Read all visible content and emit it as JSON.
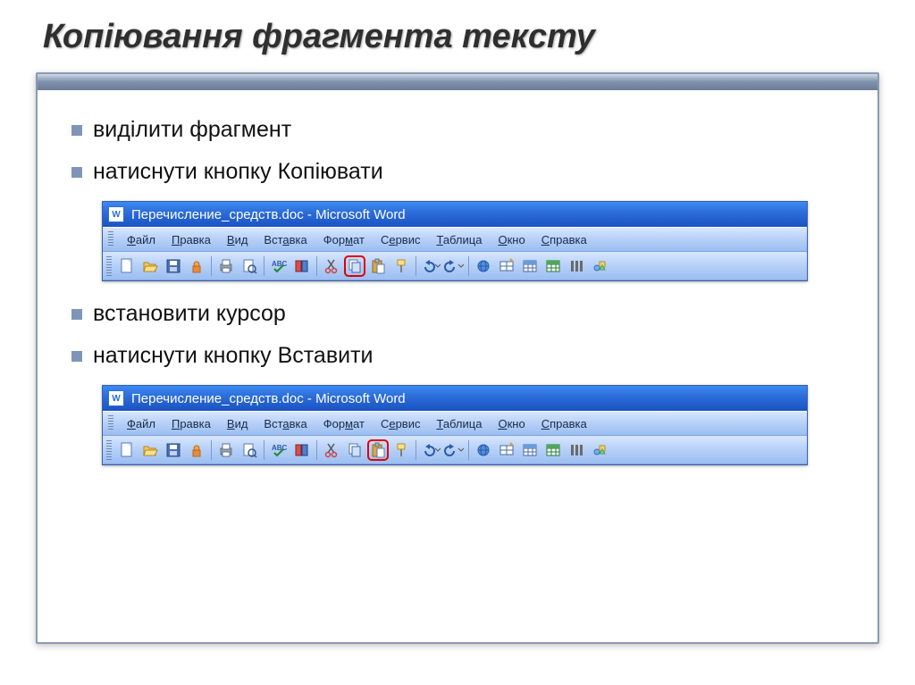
{
  "title": "Копіювання фрагмента тексту",
  "bullets": {
    "b1": "виділити фрагмент",
    "b2": "натиснути кнопку Копіювати",
    "b3": "встановити курсор",
    "b4": "натиснути кнопку Вставити"
  },
  "word": {
    "doctitle": "Перечисление_средств.doc - Microsoft Word",
    "menu": {
      "file": "Файл",
      "edit": "Правка",
      "view": "Вид",
      "insert": "Вставка",
      "format": "Формат",
      "tools": "Сервис",
      "table": "Таблица",
      "window": "Окно",
      "help": "Справка"
    },
    "icons": {
      "new": "new-doc-icon",
      "open": "open-folder-icon",
      "save": "save-icon",
      "perm": "permission-icon",
      "print": "print-icon",
      "preview": "print-preview-icon",
      "spell": "spelling-icon",
      "research": "research-icon",
      "cut": "cut-icon",
      "copy": "copy-icon",
      "paste": "paste-icon",
      "painter": "format-painter-icon",
      "undo": "undo-icon",
      "redo": "redo-icon",
      "link": "hyperlink-icon",
      "tables": "tables-borders-icon",
      "instable": "insert-table-icon",
      "excel": "insert-excel-icon",
      "cols": "columns-icon",
      "draw": "drawing-icon"
    }
  }
}
